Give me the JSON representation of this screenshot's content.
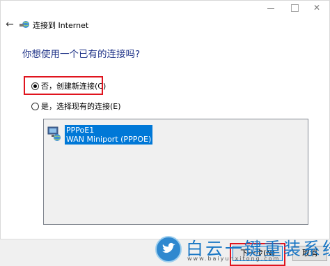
{
  "window": {
    "title": "连接到 Internet",
    "controls": {
      "minimize": "minimize-icon",
      "maximize": "maximize-icon",
      "close": "✕"
    }
  },
  "header": {
    "back_icon": "←"
  },
  "question": "你想使用一个已有的连接吗?",
  "options": [
    {
      "label": "否，创建新连接(C)",
      "checked": true
    },
    {
      "label": "是，选择现有的连接(E)",
      "checked": false
    }
  ],
  "connections": [
    {
      "name": "PPPoE1",
      "device": "WAN Miniport (PPPOE)",
      "selected": true
    }
  ],
  "buttons": {
    "next": "下一步(N)",
    "cancel": "取消"
  },
  "watermark": {
    "text": "白云一键重装系统",
    "url": "www.baiyunxitong.com"
  },
  "colors": {
    "question": "#1e3287",
    "selection": "#0078d7",
    "highlight": "#e0141e",
    "watermark": "#1a77c5"
  }
}
